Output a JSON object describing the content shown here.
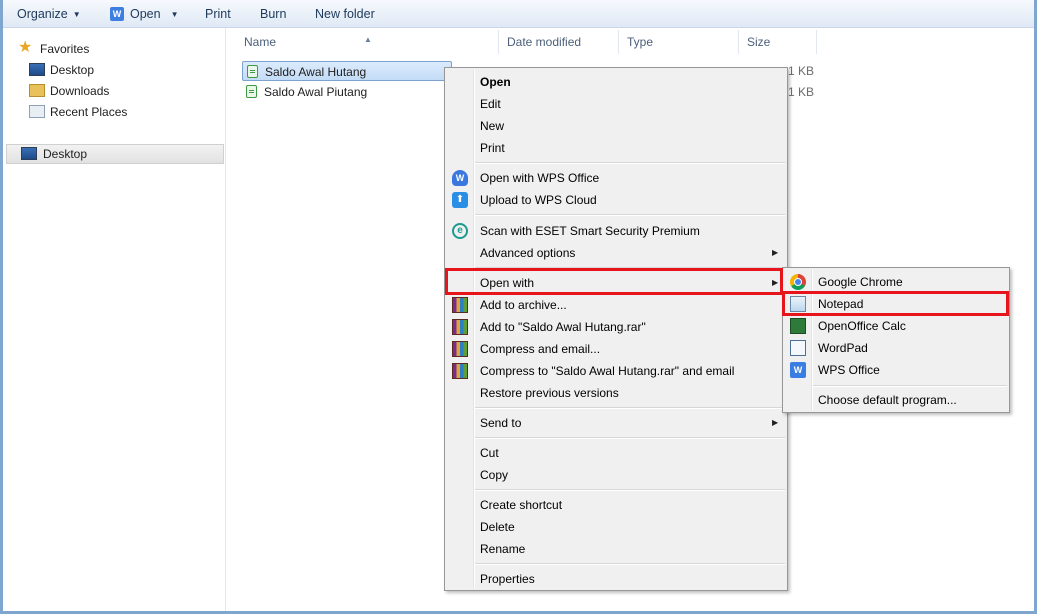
{
  "toolbar": {
    "organize": "Organize",
    "open": "Open",
    "print": "Print",
    "burn": "Burn",
    "new_folder": "New folder"
  },
  "nav": {
    "favorites": "Favorites",
    "desktop": "Desktop",
    "downloads": "Downloads",
    "recent_places": "Recent Places",
    "desktop_root": "Desktop"
  },
  "columns": {
    "name": "Name",
    "date_modified": "Date modified",
    "type": "Type",
    "size": "Size"
  },
  "files": [
    {
      "name": "Saldo Awal Hutang",
      "size": "1 KB"
    },
    {
      "name": "Saldo Awal Piutang",
      "size": "1 KB"
    }
  ],
  "context_menu": {
    "open": "Open",
    "edit": "Edit",
    "new": "New",
    "print": "Print",
    "open_wps": "Open with WPS Office",
    "upload_wps": "Upload to WPS Cloud",
    "scan_eset": "Scan with ESET Smart Security Premium",
    "advanced": "Advanced options",
    "open_with": "Open with",
    "add_archive": "Add to archive...",
    "add_rar": "Add to \"Saldo Awal Hutang.rar\"",
    "compress_email": "Compress and email...",
    "compress_rar_email": "Compress to \"Saldo Awal Hutang.rar\" and email",
    "restore": "Restore previous versions",
    "send_to": "Send to",
    "cut": "Cut",
    "copy": "Copy",
    "create_shortcut": "Create shortcut",
    "delete": "Delete",
    "rename": "Rename",
    "properties": "Properties"
  },
  "submenu": {
    "chrome": "Google Chrome",
    "notepad": "Notepad",
    "calc": "OpenOffice Calc",
    "wordpad": "WordPad",
    "wps": "WPS Office",
    "choose_default": "Choose default program..."
  },
  "colors": {
    "highlight": "#e8141b",
    "selection": "#c4dcf7",
    "frame": "#7fa6cf"
  }
}
